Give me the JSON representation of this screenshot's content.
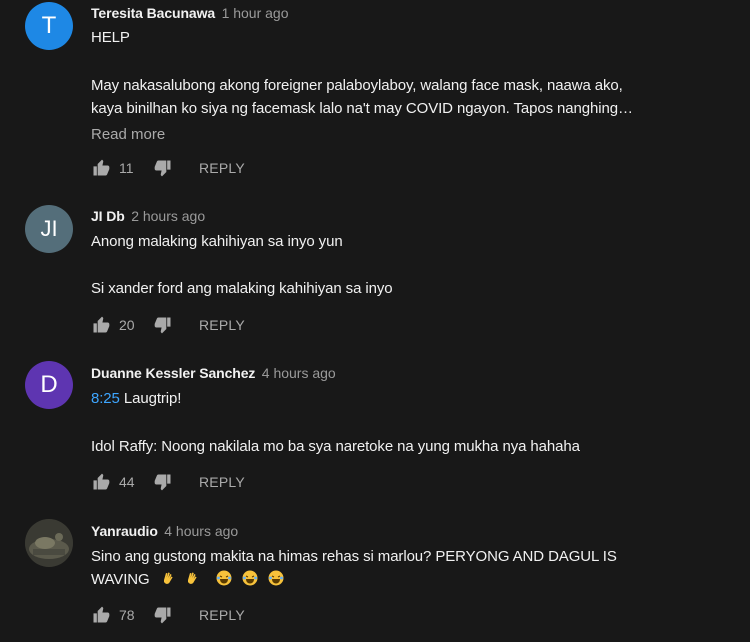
{
  "colors": {
    "background": "#181818",
    "text_primary": "#f1f1f1",
    "text_secondary": "#aaaaaa",
    "link": "#3ea6ff"
  },
  "comments": [
    {
      "avatar_letter": "T",
      "avatar_color": "#1e88e5",
      "author": "Teresita Bacunawa",
      "time": "1 hour ago",
      "lines": [
        "HELP",
        "",
        "May nakasalubong akong foreigner palaboylaboy, walang face mask, naawa ako,",
        "kaya binilhan ko siya ng facemask lalo na't may COVID ngayon. Tapos nanghing…"
      ],
      "read_more": "Read more",
      "likes": "11",
      "reply": "REPLY"
    },
    {
      "avatar_letter": "JI",
      "avatar_color": "#546e7a",
      "author": "JI Db",
      "time": "2 hours ago",
      "lines": [
        "Anong malaking kahihiyan sa inyo yun",
        "",
        "Si xander ford ang malaking kahihiyan sa inyo"
      ],
      "likes": "20",
      "reply": "REPLY"
    },
    {
      "avatar_letter": "D",
      "avatar_color": "#5e35b1",
      "author": "Duanne Kessler Sanchez",
      "time": "4 hours ago",
      "timestamp_link": "8:25",
      "first_line_rest": " Laugtrip!",
      "lines": [
        "",
        "",
        "Idol Raffy: Noong nakilala mo ba sya naretoke na yung mukha nya hahaha"
      ],
      "likes": "44",
      "reply": "REPLY"
    },
    {
      "avatar_icon": "user-photo",
      "author": "Yanraudio",
      "time": "4 hours ago",
      "lines": [
        "Sino ang gustong makita na himas rehas si marlou? PERYONG AND DAGUL IS",
        "WAVING"
      ],
      "emojis": [
        "waving-hand-emoji",
        "waving-hand-emoji",
        "laughing-emoji",
        "laughing-emoji",
        "laughing-emoji"
      ],
      "likes": "78",
      "reply": "REPLY"
    }
  ]
}
